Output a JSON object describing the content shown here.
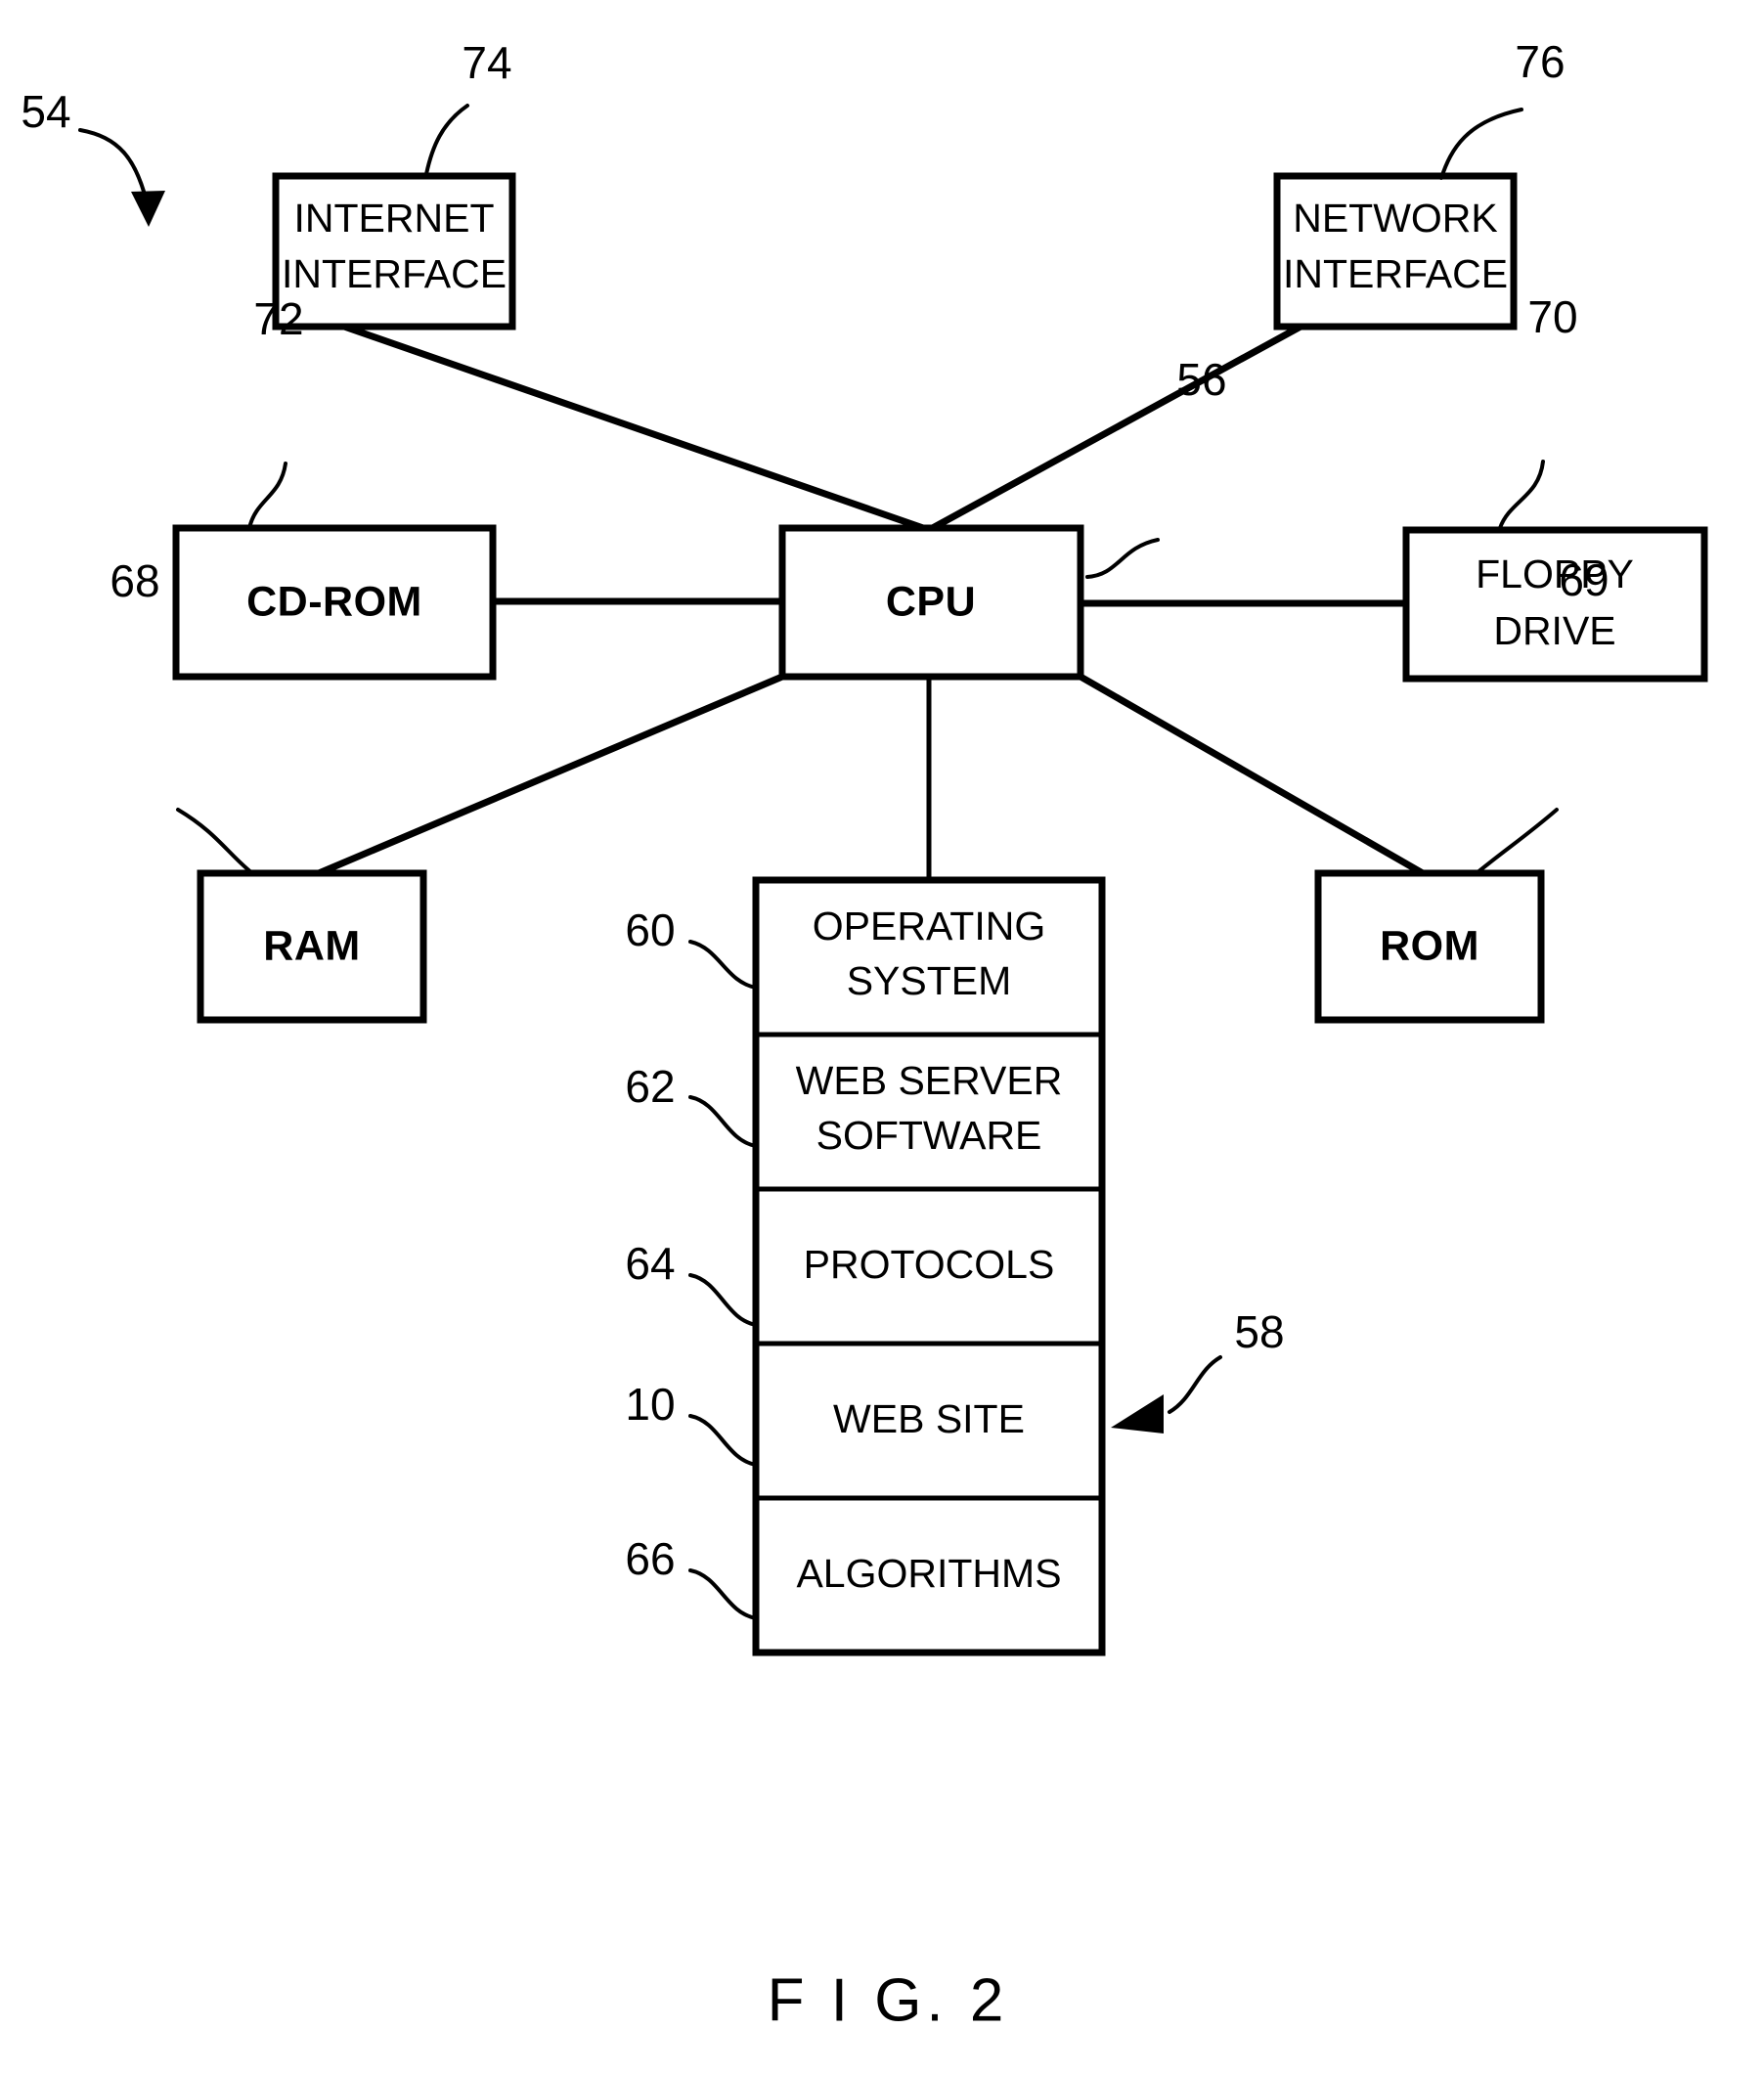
{
  "figure": {
    "caption": "F I G. 2",
    "system_ref": "54"
  },
  "nodes": {
    "internet_interface": {
      "line1": "INTERNET",
      "line2": "INTERFACE",
      "ref": "74"
    },
    "network_interface": {
      "line1": "NETWORK",
      "line2": "INTERFACE",
      "ref": "76"
    },
    "cd_rom": {
      "label": "CD-ROM",
      "ref": "72"
    },
    "cpu": {
      "label": "CPU",
      "ref": "56"
    },
    "floppy_drive": {
      "line1": "FLOPPY",
      "line2": "DRIVE",
      "ref": "70"
    },
    "ram": {
      "label": "RAM",
      "ref": "68"
    },
    "rom": {
      "label": "ROM",
      "ref": "69"
    }
  },
  "memory_stack": {
    "ref": "58",
    "items": [
      {
        "line1": "OPERATING",
        "line2": "SYSTEM",
        "ref": "60"
      },
      {
        "line1": "WEB SERVER",
        "line2": "SOFTWARE",
        "ref": "62"
      },
      {
        "line1": "PROTOCOLS",
        "line2": "",
        "ref": "64"
      },
      {
        "line1": "WEB SITE",
        "line2": "",
        "ref": "10"
      },
      {
        "line1": "ALGORITHMS",
        "line2": "",
        "ref": "66"
      }
    ]
  },
  "colors": {
    "ink": "#000000",
    "paper": "#ffffff"
  }
}
